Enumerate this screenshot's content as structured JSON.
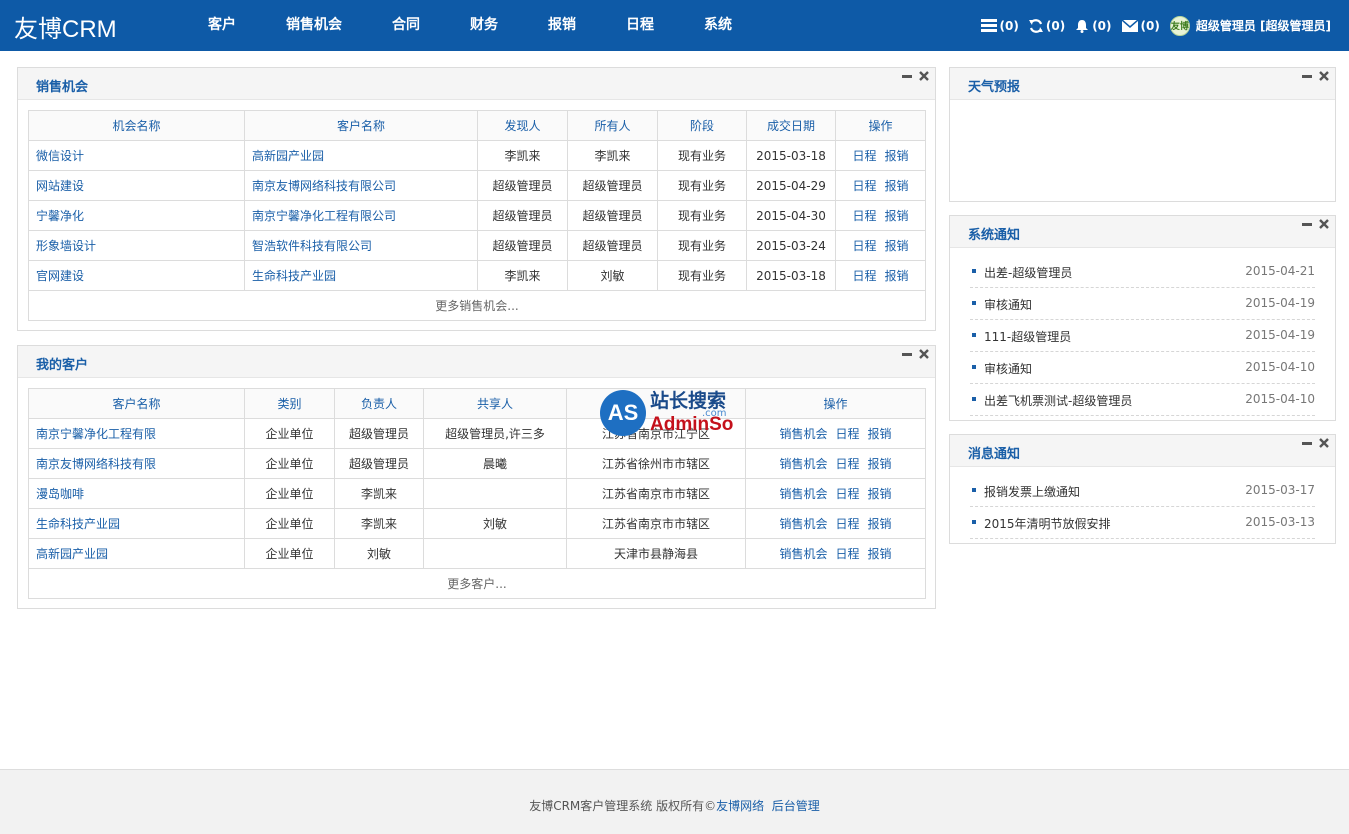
{
  "app": {
    "logo": "友博CRM"
  },
  "nav": [
    "客户",
    "销售机会",
    "合同",
    "财务",
    "报销",
    "日程",
    "系统"
  ],
  "topbar": {
    "tasks": "(0)",
    "sync": "(0)",
    "alerts": "(0)",
    "mail": "(0)",
    "avatar_text": "友博",
    "user": "超级管理员 [超级管理员]"
  },
  "sales": {
    "title": "销售机会",
    "columns": [
      "机会名称",
      "客户名称",
      "发现人",
      "所有人",
      "阶段",
      "成交日期",
      "操作"
    ],
    "rows": [
      {
        "name": "微信设计",
        "customer": "高新园产业园",
        "finder": "李凯来",
        "owner": "李凯来",
        "stage": "现有业务",
        "date": "2015-03-18"
      },
      {
        "name": "网站建设",
        "customer": "南京友博网络科技有限公司",
        "finder": "超级管理员",
        "owner": "超级管理员",
        "stage": "现有业务",
        "date": "2015-04-29"
      },
      {
        "name": "宁馨净化",
        "customer": "南京宁馨净化工程有限公司",
        "finder": "超级管理员",
        "owner": "超级管理员",
        "stage": "现有业务",
        "date": "2015-04-30"
      },
      {
        "name": "形象墙设计",
        "customer": "智浩软件科技有限公司",
        "finder": "超级管理员",
        "owner": "超级管理员",
        "stage": "现有业务",
        "date": "2015-03-24"
      },
      {
        "name": "官网建设",
        "customer": "生命科技产业园",
        "finder": "李凯来",
        "owner": "刘敏",
        "stage": "现有业务",
        "date": "2015-03-18"
      }
    ],
    "actions": [
      "日程",
      "报销"
    ],
    "more": "更多销售机会..."
  },
  "customers": {
    "title": "我的客户",
    "columns": [
      "客户名称",
      "类别",
      "负责人",
      "共享人",
      "",
      "操作"
    ],
    "rows": [
      {
        "name": "南京宁馨净化工程有限",
        "type": "企业单位",
        "manager": "超级管理员",
        "shared": "超级管理员,许三多",
        "region": "江苏省南京市江宁区"
      },
      {
        "name": "南京友博网络科技有限",
        "type": "企业单位",
        "manager": "超级管理员",
        "shared": "晨曦",
        "region": "江苏省徐州市市辖区"
      },
      {
        "name": "漫岛咖啡",
        "type": "企业单位",
        "manager": "李凯来",
        "shared": "",
        "region": "江苏省南京市市辖区"
      },
      {
        "name": "生命科技产业园",
        "type": "企业单位",
        "manager": "李凯来",
        "shared": "刘敏",
        "region": "江苏省南京市市辖区"
      },
      {
        "name": "高新园产业园",
        "type": "企业单位",
        "manager": "刘敏",
        "shared": "",
        "region": "天津市县静海县"
      }
    ],
    "actions": [
      "销售机会",
      "日程",
      "报销"
    ],
    "more": "更多客户..."
  },
  "weather": {
    "title": "天气预报"
  },
  "system_notices": {
    "title": "系统通知",
    "items": [
      {
        "text": "出差-超级管理员",
        "date": "2015-04-21"
      },
      {
        "text": "审核通知",
        "date": "2015-04-19"
      },
      {
        "text": "111-超级管理员",
        "date": "2015-04-19"
      },
      {
        "text": "审核通知",
        "date": "2015-04-10"
      },
      {
        "text": "出差飞机票测试-超级管理员",
        "date": "2015-04-10"
      }
    ]
  },
  "messages": {
    "title": "消息通知",
    "items": [
      {
        "text": "报销发票上缴通知",
        "date": "2015-03-17"
      },
      {
        "text": "2015年清明节放假安排",
        "date": "2015-03-13"
      }
    ]
  },
  "watermark": {
    "circle": "AS",
    "top": "站长搜索",
    "bottom": "AdminSo",
    "small": ".com"
  },
  "footer": {
    "text": "友博CRM客户管理系统  版权所有©",
    "company": "友博网络",
    "admin": "后台管理"
  },
  "colors": {
    "header": "#0e5aa7",
    "link": "#1a5fa8"
  }
}
